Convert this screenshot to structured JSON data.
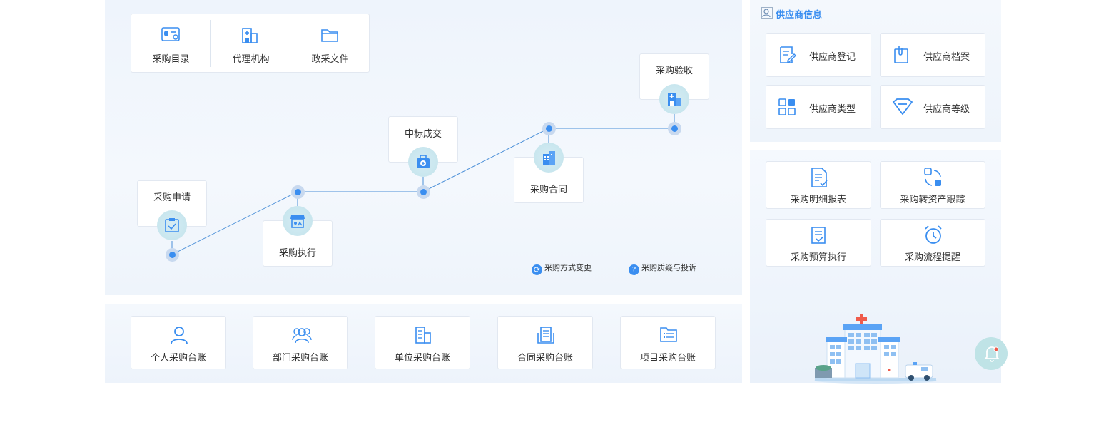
{
  "top_group": {
    "items": [
      {
        "label": "采购目录",
        "icon": "catalog-card-icon"
      },
      {
        "label": "代理机构",
        "icon": "building-icon"
      },
      {
        "label": "政采文件",
        "icon": "folder-icon"
      }
    ]
  },
  "flow": {
    "nodes": [
      {
        "label": "采购申请",
        "icon": "clipboard-check-icon"
      },
      {
        "label": "采购执行",
        "icon": "storefront-icon"
      },
      {
        "label": "中标成交",
        "icon": "medical-kit-icon"
      },
      {
        "label": "采购合同",
        "icon": "buildings-icon"
      },
      {
        "label": "采购验收",
        "icon": "hospital-building-icon"
      }
    ],
    "legend": [
      {
        "label": "采购方式变更",
        "icon": "refresh-icon"
      },
      {
        "label": "采购质疑与投诉",
        "icon": "question-icon",
        "glyph": "?"
      }
    ]
  },
  "ledger": {
    "items": [
      {
        "label": "个人采购台账",
        "icon": "person-icon"
      },
      {
        "label": "部门采购台账",
        "icon": "group-icon"
      },
      {
        "label": "单位采购台账",
        "icon": "office-icon"
      },
      {
        "label": "合同采购台账",
        "icon": "document-stack-icon"
      },
      {
        "label": "项目采购台账",
        "icon": "list-folder-icon"
      }
    ]
  },
  "supplier": {
    "title": "供应商信息",
    "items": [
      {
        "label": "供应商登记",
        "icon": "edit-form-icon"
      },
      {
        "label": "供应商档案",
        "icon": "file-clip-icon"
      },
      {
        "label": "供应商类型",
        "icon": "grid-icon"
      },
      {
        "label": "供应商等级",
        "icon": "diamond-icon"
      }
    ]
  },
  "reports": {
    "items": [
      {
        "label": "采购明细报表",
        "icon": "report-check-icon"
      },
      {
        "label": "采购转资产跟踪",
        "icon": "cycle-icon"
      },
      {
        "label": "采购预算执行",
        "icon": "budget-check-icon"
      },
      {
        "label": "采购流程提醒",
        "icon": "alarm-clock-icon"
      }
    ]
  },
  "colors": {
    "accent": "#3a8ef0",
    "node_bg": "#c8e6ee",
    "line": "#4a8fd8"
  }
}
